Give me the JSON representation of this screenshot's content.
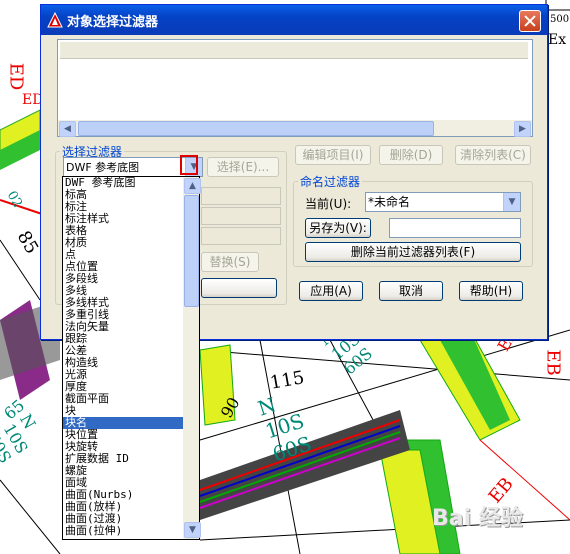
{
  "dialog": {
    "title": "对象选择过滤器",
    "select_filter_legend": "选择过滤器",
    "filter_combo_value": "DWF 参考底图",
    "select_button": "选择(E)...",
    "edit_item_button": "编辑项目(I)",
    "delete_button": "删除(D)",
    "clear_list_button": "清除列表(C)",
    "replace_button": "替换(S)",
    "named_filter_legend": "命名过滤器",
    "current_label": "当前(U):",
    "current_value": "*未命名",
    "save_as_button": "另存为(V):",
    "delete_current_button": "删除当前过滤器列表(F)",
    "apply_button": "应用(A)",
    "cancel_button": "取消",
    "help_button": "帮助(H)"
  },
  "dropdown": {
    "items": [
      "DWF 参考底图",
      "标高",
      "标注",
      "标注样式",
      "表格",
      "材质",
      "点",
      "点位置",
      "多段线",
      "多线",
      "多线样式",
      "多重引线",
      "法向矢量",
      "跟踪",
      "公差",
      "构造线",
      "光源",
      "厚度",
      "截面平面",
      "块",
      "块名",
      "块位置",
      "块旋转",
      "扩展数据 ID",
      "螺旋",
      "面域",
      "曲面(Nurbs)",
      "曲面(放样)",
      "曲面(过渡)",
      "曲面(拉伸)"
    ],
    "selected_index": 20
  },
  "drawing": {
    "labels": [
      "N 10S 60S",
      "N 10S 60S",
      "N 10S 60S",
      "115",
      "85",
      "90",
      "EB",
      "EB",
      "EB",
      "ED",
      "ED",
      "65",
      "02",
      "Ex",
      "500"
    ]
  },
  "watermark": "Bai 经验"
}
